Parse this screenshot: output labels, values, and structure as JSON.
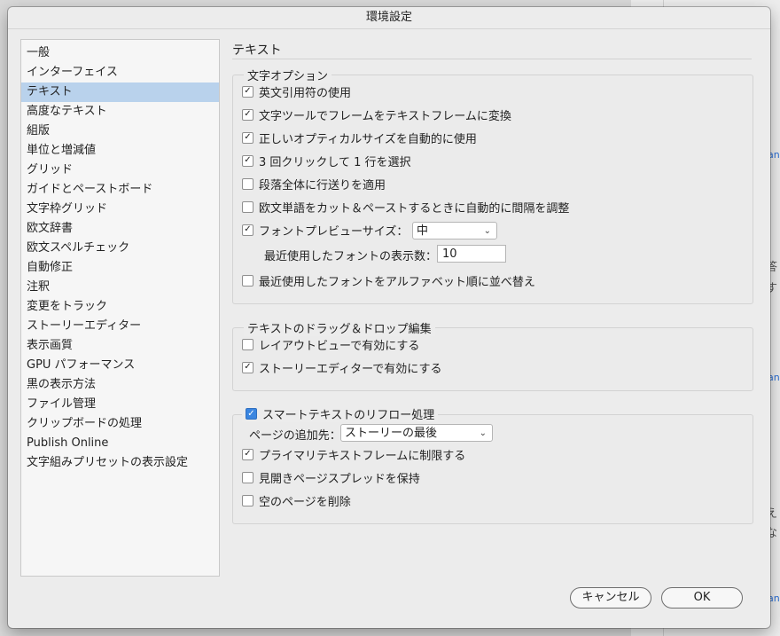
{
  "dialog": {
    "title": "環境設定"
  },
  "sidebar": {
    "items": [
      {
        "label": "一般"
      },
      {
        "label": "インターフェイス"
      },
      {
        "label": "テキスト",
        "selected": true
      },
      {
        "label": "高度なテキスト"
      },
      {
        "label": "組版"
      },
      {
        "label": "単位と増減値"
      },
      {
        "label": "グリッド"
      },
      {
        "label": "ガイドとペーストボード"
      },
      {
        "label": "文字枠グリッド"
      },
      {
        "label": "欧文辞書"
      },
      {
        "label": "欧文スペルチェック"
      },
      {
        "label": "自動修正"
      },
      {
        "label": "注釈"
      },
      {
        "label": "変更をトラック"
      },
      {
        "label": "ストーリーエディター"
      },
      {
        "label": "表示画質"
      },
      {
        "label": "GPU パフォーマンス"
      },
      {
        "label": "黒の表示方法"
      },
      {
        "label": "ファイル管理"
      },
      {
        "label": "クリップボードの処理"
      },
      {
        "label": "Publish Online"
      },
      {
        "label": "文字組みプリセットの表示設定"
      }
    ]
  },
  "panel": {
    "title": "テキスト"
  },
  "type_options": {
    "legend": "文字オプション",
    "smart_quotes": {
      "label": "英文引用符の使用",
      "checked": true
    },
    "type_tool_converts": {
      "label": "文字ツールでフレームをテキストフレームに変換",
      "checked": true
    },
    "optical_size": {
      "label": "正しいオプティカルサイズを自動的に使用",
      "checked": true
    },
    "triple_click": {
      "label": "3 回クリックして 1 行を選択",
      "checked": true
    },
    "leading_whole_para": {
      "label": "段落全体に行送りを適用",
      "checked": false
    },
    "adjust_spacing": {
      "label": "欧文単語をカット＆ペーストするときに自動的に間隔を調整",
      "checked": false
    },
    "font_preview": {
      "label": "フォントプレビューサイズ：",
      "checked": true,
      "value": "中"
    },
    "recent_fonts": {
      "label": "最近使用したフォントの表示数：",
      "value": "10"
    },
    "sort_alpha": {
      "label": "最近使用したフォントをアルファベット順に並べ替え",
      "checked": false
    }
  },
  "drag_drop": {
    "legend": "テキストのドラッグ＆ドロップ編集",
    "layout_view": {
      "label": "レイアウトビューで有効にする",
      "checked": false
    },
    "story_editor": {
      "label": "ストーリーエディターで有効にする",
      "checked": true
    }
  },
  "smart_reflow": {
    "legend": "スマートテキストのリフロー処理",
    "checked": true,
    "add_pages_label": "ページの追加先：",
    "add_pages_value": "ストーリーの最後",
    "limit_primary": {
      "label": "プライマリテキストフレームに制限する",
      "checked": true
    },
    "preserve_spreads": {
      "label": "見開きページスプレッドを保持",
      "checked": false
    },
    "delete_empty": {
      "label": "空のページを削除",
      "checked": false
    }
  },
  "buttons": {
    "cancel": "キャンセル",
    "ok": "OK"
  },
  "background": {
    "frag1": "答",
    "frag2": "す",
    "frag3": "。",
    "frag4": "え",
    "frag5": "な",
    "link": "an"
  },
  "icons": {
    "checkmark": "✓",
    "chevron": "chevron-down-icon"
  }
}
